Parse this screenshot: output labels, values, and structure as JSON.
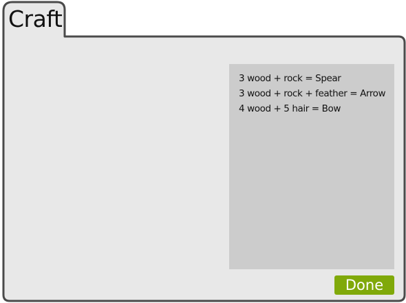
{
  "window": {
    "title": "Craft"
  },
  "recipes": [
    "3 wood + rock = Spear",
    "3 wood + rock + feather = Arrow",
    "4 wood + 5 hair = Bow"
  ],
  "buttons": {
    "done_label": "Done"
  },
  "colors": {
    "window_fill": "#e8e8e8",
    "window_border": "#4a4a4a",
    "panel_fill": "#cccccc",
    "done_button": "#80a90a"
  }
}
